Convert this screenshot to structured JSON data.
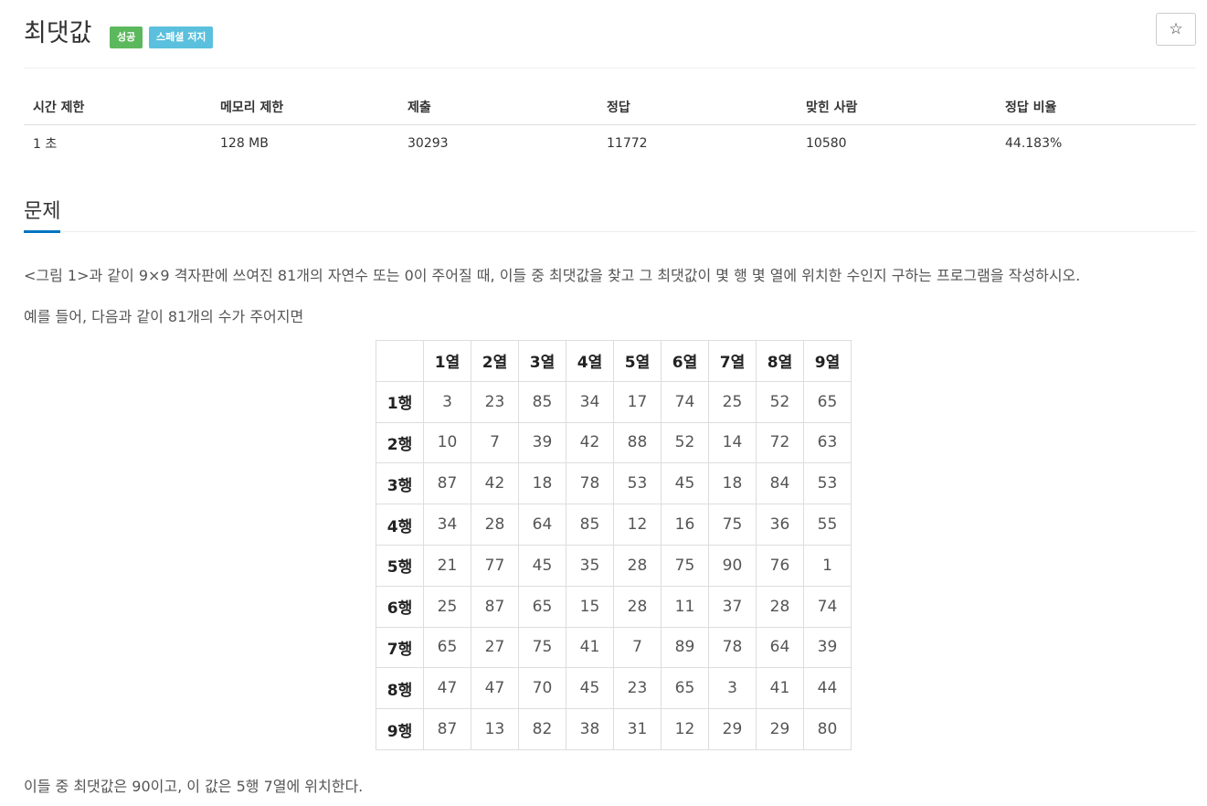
{
  "problem": {
    "title": "최댓값",
    "badges": [
      "성공",
      "스페셜 저지"
    ],
    "star_icon": "☆"
  },
  "info": {
    "headers": [
      "시간 제한",
      "메모리 제한",
      "제출",
      "정답",
      "맞힌 사람",
      "정답 비율"
    ],
    "values": [
      "1 초",
      "128 MB",
      "30293",
      "11772",
      "10580",
      "44.183%"
    ]
  },
  "section": {
    "title": "문제"
  },
  "description": {
    "p1": "<그림 1>과 같이 9×9 격자판에 쓰여진 81개의 자연수 또는 0이 주어질 때, 이들 중 최댓값을 찾고 그 최댓값이 몇 행 몇 열에 위치한 수인지 구하는 프로그램을 작성하시오.",
    "p2": "예를 들어, 다음과 같이 81개의 수가 주어지면",
    "p3": "이들 중 최댓값은 90이고, 이 값은 5행 7열에 위치한다."
  },
  "grid": {
    "col_headers": [
      "",
      "1열",
      "2열",
      "3열",
      "4열",
      "5열",
      "6열",
      "7열",
      "8열",
      "9열"
    ],
    "rows": [
      {
        "label": "1행",
        "values": [
          "3",
          "23",
          "85",
          "34",
          "17",
          "74",
          "25",
          "52",
          "65"
        ]
      },
      {
        "label": "2행",
        "values": [
          "10",
          "7",
          "39",
          "42",
          "88",
          "52",
          "14",
          "72",
          "63"
        ]
      },
      {
        "label": "3행",
        "values": [
          "87",
          "42",
          "18",
          "78",
          "53",
          "45",
          "18",
          "84",
          "53"
        ]
      },
      {
        "label": "4행",
        "values": [
          "34",
          "28",
          "64",
          "85",
          "12",
          "16",
          "75",
          "36",
          "55"
        ]
      },
      {
        "label": "5행",
        "values": [
          "21",
          "77",
          "45",
          "35",
          "28",
          "75",
          "90",
          "76",
          "1"
        ]
      },
      {
        "label": "6행",
        "values": [
          "25",
          "87",
          "65",
          "15",
          "28",
          "11",
          "37",
          "28",
          "74"
        ]
      },
      {
        "label": "7행",
        "values": [
          "65",
          "27",
          "75",
          "41",
          "7",
          "89",
          "78",
          "64",
          "39"
        ]
      },
      {
        "label": "8행",
        "values": [
          "47",
          "47",
          "70",
          "45",
          "23",
          "65",
          "3",
          "41",
          "44"
        ]
      },
      {
        "label": "9행",
        "values": [
          "87",
          "13",
          "82",
          "38",
          "31",
          "12",
          "29",
          "29",
          "80"
        ]
      }
    ]
  },
  "colors": {
    "success_badge": "#5cb85c",
    "special_badge": "#5bc0de",
    "section_underline": "#0076c0"
  }
}
